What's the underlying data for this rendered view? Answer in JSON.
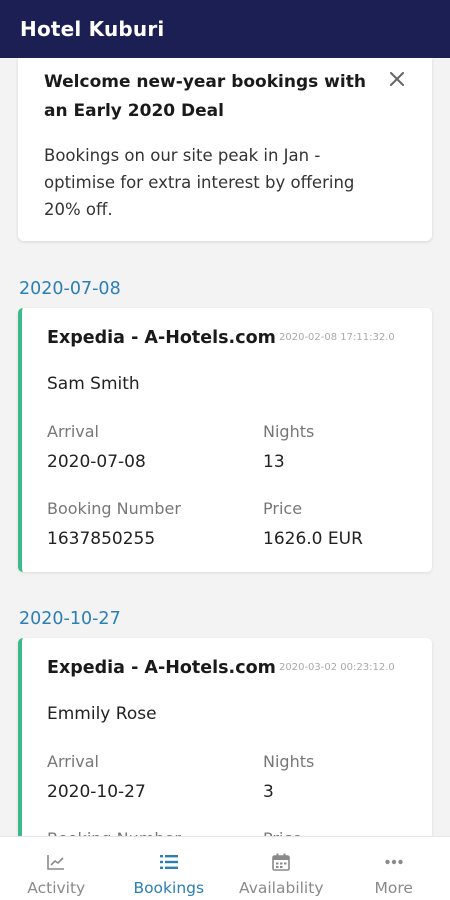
{
  "app": {
    "title": "Hotel Kuburi"
  },
  "promo": {
    "title": "Welcome new-year bookings with an Early 2020 Deal",
    "body": "Bookings on our site peak in Jan - optimise for extra interest by offering 20% off."
  },
  "labels": {
    "arrival": "Arrival",
    "nights": "Nights",
    "booking_number": "Booking Number",
    "price": "Price"
  },
  "bookings": [
    {
      "date": "2020-07-08",
      "channel": "Expedia - A-Hotels.com",
      "timestamp": "2020-02-08 17:11:32.0",
      "guest": "Sam Smith",
      "arrival": "2020-07-08",
      "nights": "13",
      "booking_number": "1637850255",
      "price": "1626.0 EUR"
    },
    {
      "date": "2020-10-27",
      "channel": "Expedia - A-Hotels.com",
      "timestamp": "2020-03-02 00:23:12.0",
      "guest": "Emmily Rose",
      "arrival": "2020-10-27",
      "nights": "3",
      "booking_number": "",
      "price": ""
    }
  ],
  "tabs": [
    {
      "label": "Activity",
      "icon": "chart-icon",
      "active": false
    },
    {
      "label": "Bookings",
      "icon": "list-icon",
      "active": true
    },
    {
      "label": "Availability",
      "icon": "calendar-icon",
      "active": false
    },
    {
      "label": "More",
      "icon": "more-icon",
      "active": false
    }
  ],
  "colors": {
    "header": "#1c1f54",
    "accent": "#2a7fb5",
    "card_border": "#3bb98a"
  }
}
